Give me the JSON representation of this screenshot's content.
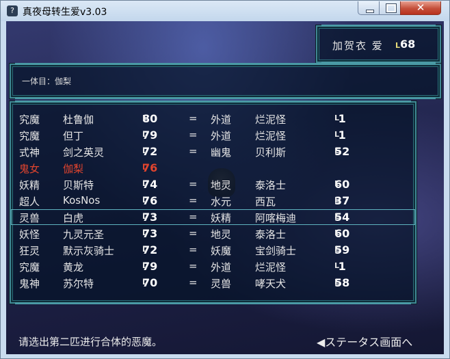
{
  "window": {
    "title": "真夜母转生爱v3.03",
    "icon": "app-icon"
  },
  "titlebar_buttons": {
    "minimize": "minimize-icon",
    "maximize": "maximize-icon",
    "close": "✕"
  },
  "player": {
    "name": "加贺衣 爱",
    "level_prefix": "L",
    "level": "68"
  },
  "first_demon": {
    "label": "一体目：伽梨"
  },
  "list": {
    "rows": [
      {
        "race_a": "究魔",
        "name_a": "杜鲁伽",
        "lv_a": "80",
        "eq": "=",
        "race_b": "外道",
        "name_b": "烂泥怪",
        "lv_b": " 1"
      },
      {
        "race_a": "究魔",
        "name_a": "但丁",
        "lv_a": "79",
        "eq": "=",
        "race_b": "外道",
        "name_b": "烂泥怪",
        "lv_b": " 1"
      },
      {
        "race_a": "式神",
        "name_a": "剑之英灵",
        "lv_a": "72",
        "eq": "=",
        "race_b": "幽鬼",
        "name_b": "贝利斯",
        "lv_b": "52"
      },
      {
        "race_a": "鬼女",
        "name_a": "伽梨",
        "lv_a": "76",
        "eq": "",
        "race_b": "",
        "name_b": "",
        "lv_b": ""
      },
      {
        "race_a": "妖精",
        "name_a": "贝斯特",
        "lv_a": "74",
        "eq": "=",
        "race_b": "地灵",
        "name_b": "泰洛士",
        "lv_b": "60"
      },
      {
        "race_a": "超人",
        "name_a": "KosNos",
        "lv_a": "76",
        "eq": "=",
        "race_b": "水元",
        "name_b": "西瓦",
        "lv_b": "37"
      },
      {
        "race_a": "灵兽",
        "name_a": "白虎",
        "lv_a": "73",
        "eq": "=",
        "race_b": "妖精",
        "name_b": "阿喀梅迪",
        "lv_b": "54"
      },
      {
        "race_a": "妖怪",
        "name_a": "九灵元圣",
        "lv_a": "73",
        "eq": "=",
        "race_b": "地灵",
        "name_b": "泰洛士",
        "lv_b": "60"
      },
      {
        "race_a": "狂灵",
        "name_a": "默示灰骑士",
        "lv_a": "72",
        "eq": "=",
        "race_b": "妖魔",
        "name_b": "宝剑骑士",
        "lv_b": "59"
      },
      {
        "race_a": "究魔",
        "name_a": "黄龙",
        "lv_a": "79",
        "eq": "=",
        "race_b": "外道",
        "name_b": "烂泥怪",
        "lv_b": " 1"
      },
      {
        "race_a": "鬼神",
        "name_a": "苏尔特",
        "lv_a": "70",
        "eq": "=",
        "race_b": "灵兽",
        "name_b": "哮天犬",
        "lv_b": "58"
      }
    ],
    "highlight_color": "#e0442e",
    "selected_row": 6,
    "highlight_row": 3
  },
  "footer": {
    "hint": "请选出第二匹进行合体的恶魔。",
    "status_link": "◀ステータス画面へ"
  }
}
